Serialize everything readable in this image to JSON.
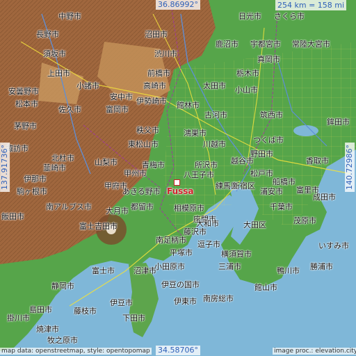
{
  "map": {
    "center_label": "Fussa",
    "lat_top": "36.86992°",
    "lat_bottom": "34.58706°",
    "lon_left": "137.91736°",
    "lon_right": "140.72986°",
    "scale": "254 km = 158 mi",
    "attribution_left": "map data: openstreetmap, style: opentopomap",
    "attribution_right": "image proc.: elevation.city",
    "colors": {
      "sea": "#7fb7d8",
      "lowland": "#4ea34a",
      "mountain": "#a0673e",
      "marker": "#d0202a",
      "coord_text": "#2d5fb8"
    }
  },
  "cities": [
    {
      "name": "中野市"
    },
    {
      "name": "日光市"
    },
    {
      "name": "さくら市"
    },
    {
      "name": "長野市"
    },
    {
      "name": "沼田市"
    },
    {
      "name": "鹿沼市"
    },
    {
      "name": "宇都宮市"
    },
    {
      "name": "常陸大宮市"
    },
    {
      "name": "須坂市"
    },
    {
      "name": "渋川市"
    },
    {
      "name": "真岡市"
    },
    {
      "name": "上田市"
    },
    {
      "name": "前橋市"
    },
    {
      "name": "栃木市"
    },
    {
      "name": "小諸市"
    },
    {
      "name": "高崎市"
    },
    {
      "name": "太田市"
    },
    {
      "name": "小山市"
    },
    {
      "name": "安曇野市"
    },
    {
      "name": "松本市"
    },
    {
      "name": "安中市"
    },
    {
      "name": "佐久市"
    },
    {
      "name": "伊勢崎市"
    },
    {
      "name": "富岡市"
    },
    {
      "name": "館林市"
    },
    {
      "name": "古河市"
    },
    {
      "name": "筑西市"
    },
    {
      "name": "茅野市"
    },
    {
      "name": "秩父市"
    },
    {
      "name": "鴻巣市"
    },
    {
      "name": "つくば市"
    },
    {
      "name": "東松山市"
    },
    {
      "name": "川越市"
    },
    {
      "name": "野田市"
    },
    {
      "name": "諏訪市"
    },
    {
      "name": "山梨市"
    },
    {
      "name": "青梅市"
    },
    {
      "name": "所沢市"
    },
    {
      "name": "越谷市"
    },
    {
      "name": "甲州市"
    },
    {
      "name": "八王子市"
    },
    {
      "name": "松戸市"
    },
    {
      "name": "船橋市"
    },
    {
      "name": "甲府市"
    },
    {
      "name": "あきる野市"
    },
    {
      "name": "練馬区"
    },
    {
      "name": "新宿区"
    },
    {
      "name": "浦安市"
    },
    {
      "name": "都留市"
    },
    {
      "name": "相模原市"
    },
    {
      "name": "大月市"
    },
    {
      "name": "千葉市"
    },
    {
      "name": "座間市"
    },
    {
      "name": "大田区"
    },
    {
      "name": "富士吉田市"
    },
    {
      "name": "藤沢市"
    },
    {
      "name": "大和市"
    },
    {
      "name": "逗子市"
    },
    {
      "name": "南足柄市"
    },
    {
      "name": "平塚市"
    },
    {
      "name": "横須賀市"
    },
    {
      "name": "小田原市"
    },
    {
      "name": "三浦市"
    },
    {
      "name": "富士市"
    },
    {
      "name": "沼津市"
    },
    {
      "name": "伊豆の国市"
    },
    {
      "name": "伊東市"
    },
    {
      "name": "静岡市"
    },
    {
      "name": "伊豆市"
    },
    {
      "name": "南房総市"
    },
    {
      "name": "館山市"
    },
    {
      "name": "鴨川市"
    },
    {
      "name": "勝浦市"
    },
    {
      "name": "いすみ市"
    },
    {
      "name": "茂原市"
    },
    {
      "name": "藤枝市"
    },
    {
      "name": "島田市"
    },
    {
      "name": "焼津市"
    },
    {
      "name": "下田市"
    },
    {
      "name": "牧之原市"
    },
    {
      "name": "掛川市"
    },
    {
      "name": "富里市"
    },
    {
      "name": "成田市"
    },
    {
      "name": "香取市"
    },
    {
      "name": "鉾田市"
    },
    {
      "name": "飯田市"
    },
    {
      "name": "伊那市"
    },
    {
      "name": "駒ヶ根市"
    },
    {
      "name": "韮崎市"
    },
    {
      "name": "北杜市"
    },
    {
      "name": "南アルプス市"
    }
  ]
}
